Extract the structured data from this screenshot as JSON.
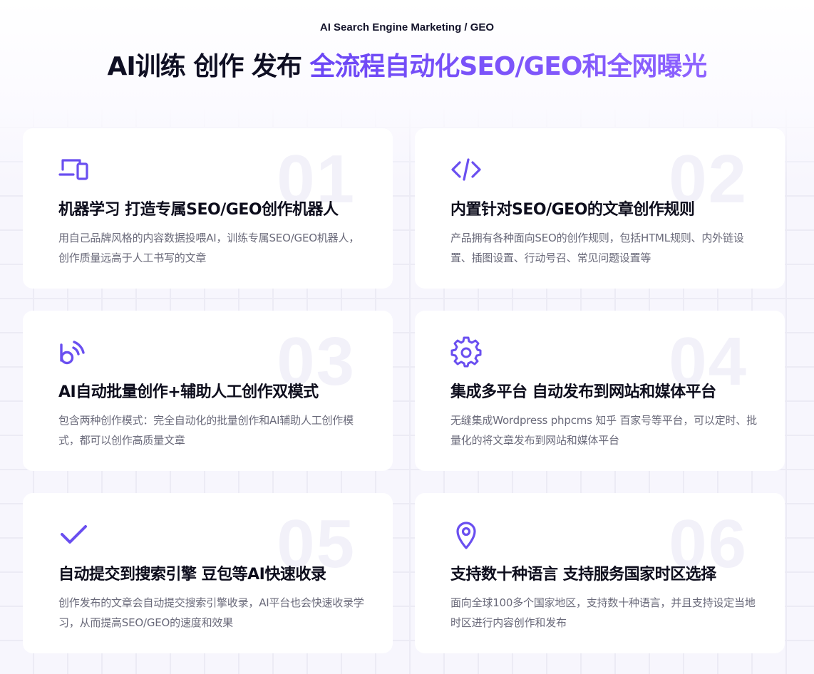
{
  "header": {
    "eyebrow": "AI Search Engine Marketing / GEO",
    "headline_dark": "AI训练 创作 发布 ",
    "headline_accent": "全流程自动化SEO/GEO和全网曝光"
  },
  "colors": {
    "accent": "#6a4ff0",
    "title": "#0d0d1c",
    "desc": "#6a6a7a",
    "card_bg": "#ffffff"
  },
  "features": [
    {
      "icon": "devices-icon",
      "number": "01",
      "title": "机器学习 打造专属SEO/GEO创作机器人",
      "desc": "用自己品牌风格的内容数据投喂AI，训练专属SEO/GEO机器人，创作质量远高于人工书写的文章"
    },
    {
      "icon": "code-icon",
      "number": "02",
      "title": "内置针对SEO/GEO的文章创作规则",
      "desc": "产品拥有各种面向SEO的创作规则，包括HTML规则、内外链设置、插图设置、行动号召、常见问题设置等"
    },
    {
      "icon": "broadcast-icon",
      "number": "03",
      "title": "AI自动批量创作+辅助人工创作双模式",
      "desc": "包含两种创作模式：完全自动化的批量创作和AI辅助人工创作模式，都可以创作高质量文章"
    },
    {
      "icon": "gear-icon",
      "number": "04",
      "title": "集成多平台 自动发布到网站和媒体平台",
      "desc": "无缝集成Wordpress phpcms 知乎 百家号等平台，可以定时、批量化的将文章发布到网站和媒体平台"
    },
    {
      "icon": "check-icon",
      "number": "05",
      "title": "自动提交到搜索引擎 豆包等AI快速收录",
      "desc": "创作发布的文章会自动提交搜索引擎收录，AI平台也会快速收录学习，从而提高SEO/GEO的速度和效果"
    },
    {
      "icon": "location-pin-icon",
      "number": "06",
      "title": "支持数十种语言 支持服务国家时区选择",
      "desc": "面向全球100多个国家地区，支持数十种语言，并且支持设定当地时区进行内容创作和发布"
    }
  ]
}
